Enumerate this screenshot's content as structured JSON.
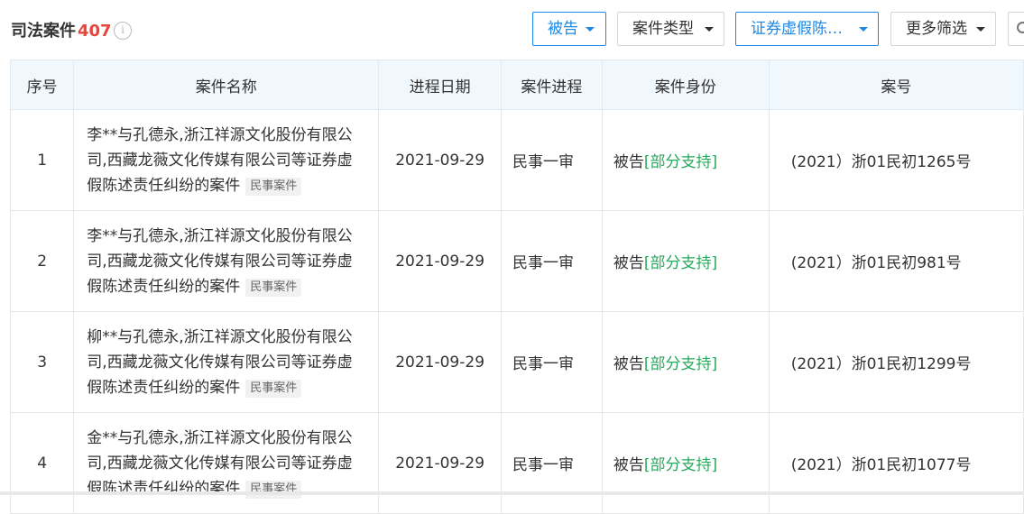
{
  "header": {
    "title": "司法案件",
    "count": "407",
    "info_icon": "info-circle-icon"
  },
  "filters": [
    {
      "label": "被告",
      "active": true
    },
    {
      "label": "案件类型",
      "active": false
    },
    {
      "label": "证券虚假陈…",
      "active": true
    },
    {
      "label": "更多筛选",
      "active": false
    }
  ],
  "colors": {
    "accent": "#1e88e5",
    "count": "#e6473a",
    "support": "#27a85a",
    "header_bg": "#f0f7fd"
  },
  "table": {
    "columns": [
      "序号",
      "案件名称",
      "进程日期",
      "案件进程",
      "案件身份",
      "案号"
    ],
    "rows": [
      {
        "no": "1",
        "name": "李**与孔德永,浙江祥源文化股份有限公司,西藏龙薇文化传媒有限公司等证券虚假陈述责任纠纷的案件",
        "tag": "民事案件",
        "date": "2021-09-29",
        "progress": "民事一审",
        "role": "被告",
        "support": "[部分支持]",
        "case_no": "(2021）浙01民初1265号"
      },
      {
        "no": "2",
        "name": "李**与孔德永,浙江祥源文化股份有限公司,西藏龙薇文化传媒有限公司等证券虚假陈述责任纠纷的案件",
        "tag": "民事案件",
        "date": "2021-09-29",
        "progress": "民事一审",
        "role": "被告",
        "support": "[部分支持]",
        "case_no": "(2021）浙01民初981号"
      },
      {
        "no": "3",
        "name": "柳**与孔德永,浙江祥源文化股份有限公司,西藏龙薇文化传媒有限公司等证券虚假陈述责任纠纷的案件",
        "tag": "民事案件",
        "date": "2021-09-29",
        "progress": "民事一审",
        "role": "被告",
        "support": "[部分支持]",
        "case_no": "(2021）浙01民初1299号"
      },
      {
        "no": "4",
        "name": "金**与孔德永,浙江祥源文化股份有限公司,西藏龙薇文化传媒有限公司等证券虚假陈述责任纠纷的案件",
        "tag": "民事案件",
        "date": "2021-09-29",
        "progress": "民事一审",
        "role": "被告",
        "support": "[部分支持]",
        "case_no": "(2021）浙01民初1077号"
      }
    ]
  }
}
